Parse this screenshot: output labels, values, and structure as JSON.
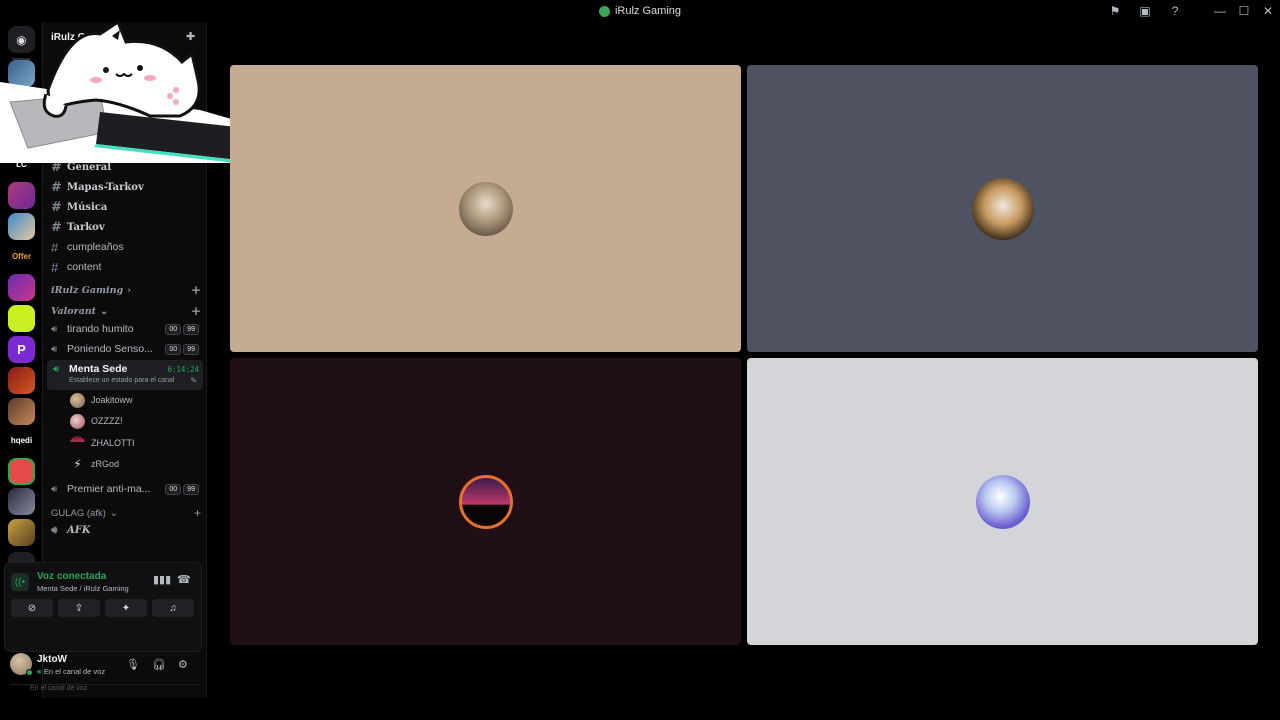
{
  "window": {
    "title": "iRulz Gaming",
    "icons": [
      "flag-icon",
      "inbox-icon",
      "help-icon"
    ],
    "controls": [
      "minimize",
      "maximize",
      "close"
    ]
  },
  "rail": {
    "text_labels": [
      "LC",
      "Offer",
      "hqedi"
    ]
  },
  "server": {
    "name": "iRulz Gami",
    "text_channels": [
      "General",
      "Mapas-Tarkov",
      "Música",
      "Tarkov",
      "cumpleaños",
      "content"
    ],
    "categories": {
      "irulz": "iRulz Gaming",
      "valorant": "Valorant",
      "gulag": "GULAG (afk)"
    },
    "voice_channels": [
      {
        "name": "tirando humito",
        "b1": "00",
        "b2": "99"
      },
      {
        "name": "Poniendo Senso...",
        "b1": "00",
        "b2": "99"
      },
      {
        "name": "Premier anti-ma...",
        "b1": "00",
        "b2": "99"
      }
    ],
    "active_voice": {
      "name": "Menta Sede",
      "timer": "6:14:24",
      "status": "Establece un estado para el canal"
    },
    "members": [
      "Joakitoww",
      "OZZZZ!",
      "ZHALOTTI",
      "zRGod"
    ],
    "afk_channel": "AFK"
  },
  "voice": {
    "title": "Voz conectada",
    "subtitle": "Menta Sede / iRulz Gaming"
  },
  "user": {
    "name": "JktoW",
    "status": "En el canal de voz",
    "ghost": "En el canal de voz"
  },
  "colors": {
    "tile1": "#c4ab92",
    "tile2": "#4f5261",
    "tile3": "#200f15",
    "tile4": "#d4d5d8",
    "accent_green": "#23a55a"
  }
}
